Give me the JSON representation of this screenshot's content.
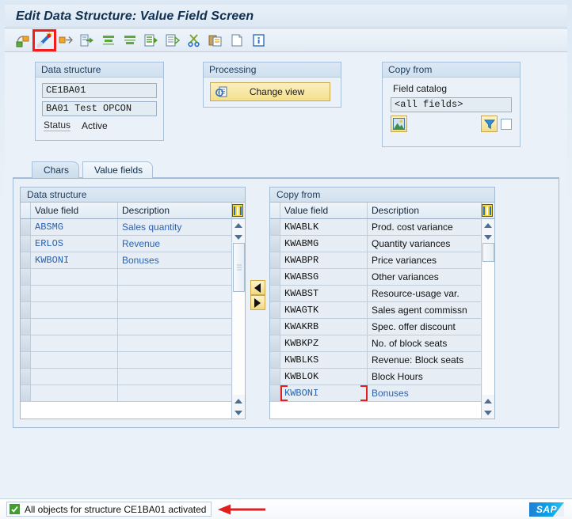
{
  "window": {
    "title": "Edit Data Structure: Value Field Screen"
  },
  "toolbar": {
    "buttons": [
      {
        "name": "back-icon",
        "label": "Back"
      },
      {
        "name": "magic-wand-icon",
        "label": "Execute / Create",
        "selected": true
      },
      {
        "name": "exit-icon",
        "label": "Exit"
      },
      {
        "name": "activate-icon",
        "label": "Activate"
      },
      {
        "name": "align-top-icon",
        "label": "Insert Line Above"
      },
      {
        "name": "align-bottom-icon",
        "label": "Insert Line Below"
      },
      {
        "name": "page-forward-icon",
        "label": "Transport"
      },
      {
        "name": "page-detail-icon",
        "label": "Display Detail"
      },
      {
        "name": "scissors-icon",
        "label": "Cut"
      },
      {
        "name": "clipboard-icon",
        "label": "Paste"
      },
      {
        "name": "new-page-icon",
        "label": "New Entry"
      },
      {
        "name": "info-icon",
        "label": "Information"
      }
    ]
  },
  "data_structure_group": {
    "title": "Data structure",
    "name_value": "CE1BA01",
    "description_value": "BA01 Test OPCON",
    "status_label": "Status",
    "status_value": "Active"
  },
  "processing_group": {
    "title": "Processing",
    "change_view_label": "Change view",
    "change_view_icon": "change-view-icon"
  },
  "copy_from_group": {
    "title": "Copy from",
    "field_catalog_label": "Field catalog",
    "field_catalog_value": "<all fields>",
    "picture_icon": "picture-icon",
    "filter_icon": "filter-icon",
    "checkbox_checked": false
  },
  "tabs": [
    {
      "label": "Chars",
      "name": "tab-chars",
      "active": false
    },
    {
      "label": "Value fields",
      "name": "tab-value-fields",
      "active": true
    }
  ],
  "left_table": {
    "title": "Data structure",
    "columns": [
      "Value field",
      "Description"
    ],
    "rows": [
      {
        "field": "ABSMG",
        "desc": "Sales quantity"
      },
      {
        "field": "ERLOS",
        "desc": "Revenue"
      },
      {
        "field": "KWBONI",
        "desc": "Bonuses"
      }
    ],
    "empty_rows": 8,
    "column_config_icon": "column-config-icon"
  },
  "transfer": {
    "move_left_label": "Move left",
    "move_right_label": "Move right",
    "left_icon": "arrow-left-icon",
    "right_icon": "arrow-right-icon"
  },
  "right_table": {
    "title": "Copy from",
    "columns": [
      "Value field",
      "Description"
    ],
    "rows": [
      {
        "field": "KWABLK",
        "desc": "Prod. cost variance",
        "selected": false
      },
      {
        "field": "KWABMG",
        "desc": "Quantity variances",
        "selected": false
      },
      {
        "field": "KWABPR",
        "desc": "Price variances",
        "selected": false
      },
      {
        "field": "KWABSG",
        "desc": "Other variances",
        "selected": false
      },
      {
        "field": "KWABST",
        "desc": "Resource-usage var.",
        "selected": false
      },
      {
        "field": "KWAGTK",
        "desc": "Sales agent commissn",
        "selected": false
      },
      {
        "field": "KWAKRB",
        "desc": "Spec. offer discount",
        "selected": false
      },
      {
        "field": "KWBKPZ",
        "desc": "No. of block seats",
        "selected": false
      },
      {
        "field": "KWBLKS",
        "desc": "Revenue: Block seats",
        "selected": false
      },
      {
        "field": "KWBLOK",
        "desc": "Block Hours",
        "selected": false
      },
      {
        "field": "KWBONI",
        "desc": "Bonuses",
        "selected": true
      }
    ],
    "column_config_icon": "column-config-icon"
  },
  "statusbar": {
    "message": "All objects for structure CE1BA01 activated",
    "status_icon": "success-check-icon",
    "annotation_icon": "red-arrow-annotation",
    "logo": "SAP"
  },
  "colors": {
    "accent": "#2a62b0",
    "highlight_red": "#f51b1b",
    "button_yellow": "#f4e08c",
    "panel_bg": "#eaf1f8",
    "brand_blue": "#0aa6e8"
  }
}
